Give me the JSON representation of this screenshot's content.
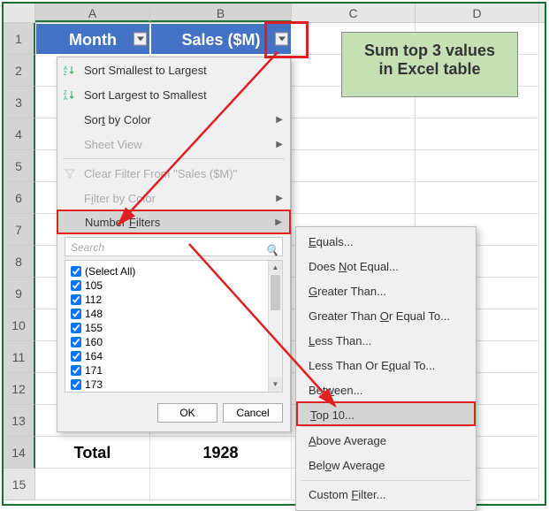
{
  "columns": [
    "A",
    "B",
    "C",
    "D"
  ],
  "rows": [
    "1",
    "2",
    "3",
    "4",
    "5",
    "6",
    "7",
    "8",
    "9",
    "10",
    "11",
    "12",
    "13",
    "14",
    "15"
  ],
  "table": {
    "headers": {
      "A": "Month",
      "B": "Sales ($M)"
    },
    "total": {
      "label": "Total",
      "value": "1928"
    }
  },
  "callout": {
    "line1": "Sum top 3 values",
    "line2": "in Excel table"
  },
  "menu": {
    "sort_asc": "Sort Smallest to Largest",
    "sort_desc": "Sort Largest to Smallest",
    "sort_color": "Sort by Color",
    "sheet_view": "Sheet View",
    "clear_filter": "Clear Filter From \"Sales ($M)\"",
    "filter_color": "Filter by Color",
    "number_filters": "Number Filters",
    "search_placeholder": "Search",
    "select_all": "(Select All)",
    "values": [
      "105",
      "112",
      "148",
      "155",
      "160",
      "164",
      "171",
      "173"
    ],
    "ok": "OK",
    "cancel": "Cancel"
  },
  "submenu": {
    "equals": "Equals...",
    "not_equal": "Does Not Equal...",
    "greater": "Greater Than...",
    "greater_eq": "Greater Than Or Equal To...",
    "less": "Less Than...",
    "less_eq": "Less Than Or Equal To...",
    "between": "Between...",
    "top10": "Top 10...",
    "above_avg": "Above Average",
    "below_avg": "Below Average",
    "custom": "Custom Filter..."
  }
}
